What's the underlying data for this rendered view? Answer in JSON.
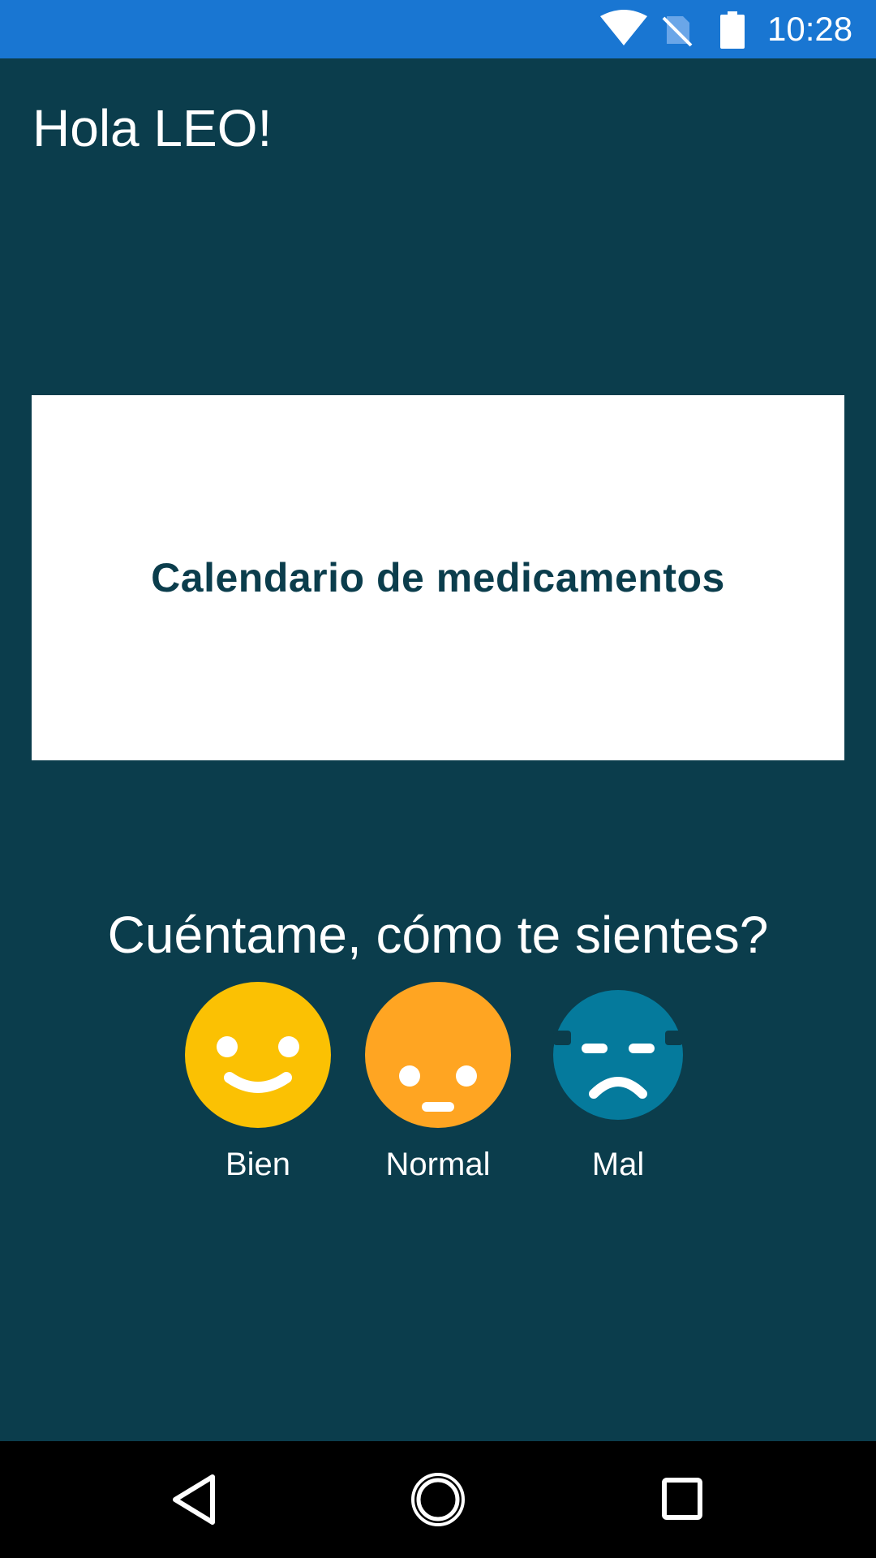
{
  "status_bar": {
    "time": "10:28",
    "icons": [
      "wifi-icon",
      "no-sim-icon",
      "battery-icon"
    ],
    "background": "#1976d2"
  },
  "greeting": "Hola LEO!",
  "calendar_card": {
    "label": "Calendario de medicamentos"
  },
  "mood": {
    "question": "Cuéntame, cómo te sientes?",
    "options": [
      {
        "label": "Bien",
        "icon": "happy-face-icon",
        "color": "#fbc103"
      },
      {
        "label": "Normal",
        "icon": "neutral-face-icon",
        "color": "#ffa522"
      },
      {
        "label": "Mal",
        "icon": "sad-face-icon",
        "color": "#057a9c"
      }
    ]
  },
  "nav_bar": {
    "icons": [
      "back-icon",
      "home-icon",
      "recents-icon"
    ]
  },
  "colors": {
    "background": "#0b3d4c",
    "card": "#ffffff"
  }
}
